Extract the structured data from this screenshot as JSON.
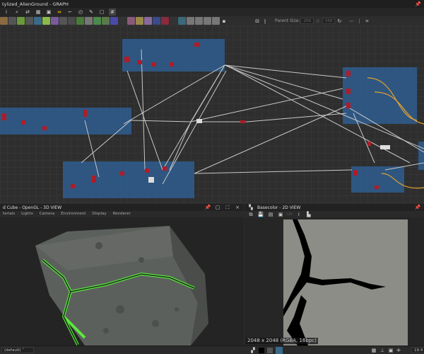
{
  "window": {
    "title": "tylized_AlienGround - GRAPH"
  },
  "toolbar": {
    "parent_size_label": "Parent Size:",
    "parent_width": "256",
    "parent_height": "256",
    "node_colors": [
      "#8a6a40",
      "#555",
      "#6a9a3a",
      "#555",
      "#3a6a8a",
      "#8aba4a",
      "#7a5a9a",
      "#555",
      "#4a4a4a",
      "#4a7a3a",
      "#777",
      "#4a8a4a",
      "#5a7a4a",
      "#4a4aaa",
      "#333",
      "#8a5a7a",
      "#9a8a4a",
      "#8a6a9a",
      "#3a4a8a",
      "#8a2a3a",
      "#333",
      "#3a6a7a",
      "#777",
      "#777",
      "#777",
      "#777"
    ]
  },
  "view3d": {
    "title": "d Cube - OpenGL - 3D VIEW",
    "menu": [
      "terials",
      "Lights",
      "Camera",
      "Environment",
      "Display",
      "Renderer"
    ],
    "material_select": "(default)"
  },
  "view2d": {
    "title": "Basecolor - 2D VIEW",
    "uv_label": "UV",
    "resolution": "2048 x 2048 (RGBA, 16bpc)",
    "zoom": "19.4"
  }
}
